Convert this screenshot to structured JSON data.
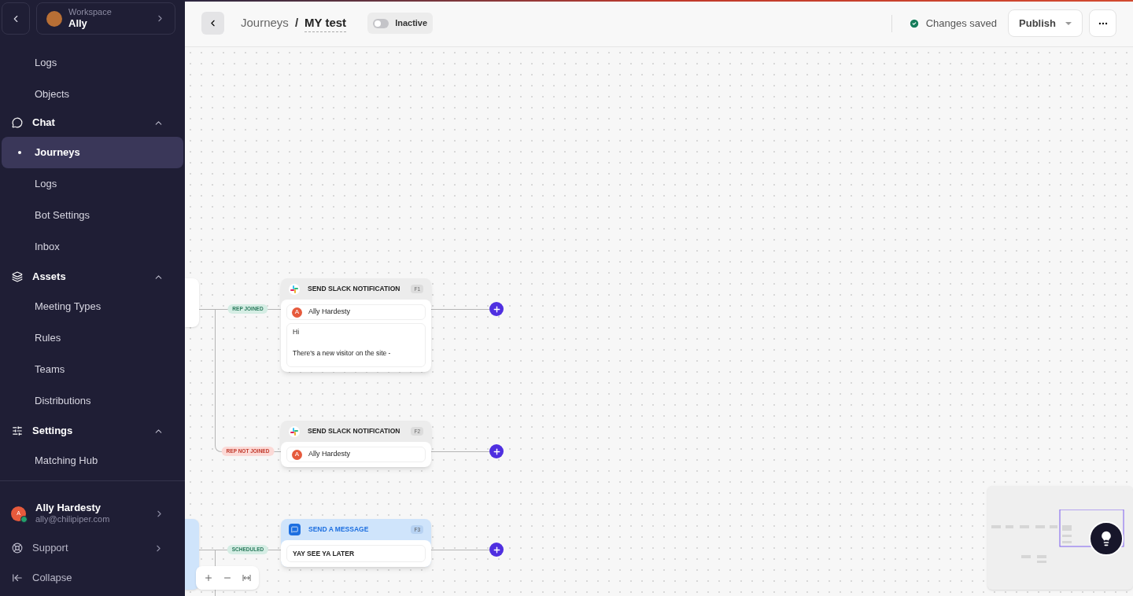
{
  "sidebar": {
    "workspace": {
      "label": "Workspace",
      "name": "Ally"
    },
    "items": [
      {
        "kind": "link",
        "label": "Logs",
        "selected": false
      },
      {
        "kind": "link",
        "label": "Objects",
        "selected": false
      },
      {
        "kind": "group",
        "label": "Chat",
        "expanded": true,
        "children": [
          {
            "label": "Journeys",
            "selected": true
          },
          {
            "label": "Logs",
            "selected": false
          },
          {
            "label": "Bot Settings",
            "selected": false
          },
          {
            "label": "Inbox",
            "selected": false
          }
        ]
      },
      {
        "kind": "group",
        "label": "Assets",
        "expanded": true,
        "children": [
          {
            "label": "Meeting Types",
            "selected": false
          },
          {
            "label": "Rules",
            "selected": false
          },
          {
            "label": "Teams",
            "selected": false
          },
          {
            "label": "Distributions",
            "selected": false
          }
        ]
      },
      {
        "kind": "group",
        "label": "Settings",
        "expanded": true,
        "children": [
          {
            "label": "Matching Hub",
            "selected": false
          }
        ]
      }
    ],
    "user": {
      "initial": "A",
      "name": "Ally Hardesty",
      "email": "ally@chilipiper.com",
      "online": true
    },
    "footer": [
      {
        "kind": "support",
        "label": "Support"
      },
      {
        "kind": "collapse",
        "label": "Collapse"
      }
    ]
  },
  "header": {
    "breadcrumb": [
      {
        "label": "Journeys"
      },
      {
        "label": "MY test"
      }
    ],
    "separator": "/",
    "status_toggle": {
      "label": "Inactive",
      "on": false
    },
    "save_status": "Changes saved",
    "publish": "Publish"
  },
  "canvas": {
    "nodes": [
      {
        "kind": "slack",
        "title": "SEND SLACK NOTIFICATION",
        "badge": "F1",
        "edge_label": {
          "text": "REP JOINED",
          "kind": "positive"
        },
        "assignee": {
          "initial": "A",
          "name": "Ally Hardesty"
        },
        "message": [
          "Hi",
          "There's a new visitor on the site -"
        ]
      },
      {
        "kind": "slack",
        "title": "SEND SLACK NOTIFICATION",
        "badge": "F2",
        "edge_label": {
          "text": "REP NOT JOINED",
          "kind": "negative"
        },
        "assignee": {
          "initial": "A",
          "name": "Ally Hardesty"
        }
      },
      {
        "kind": "message",
        "title": "SEND A MESSAGE",
        "badge": "F3",
        "edge_label": {
          "text": "SCHEDULED",
          "kind": "positive"
        },
        "text": "YAY SEE YA LATER"
      }
    ]
  }
}
